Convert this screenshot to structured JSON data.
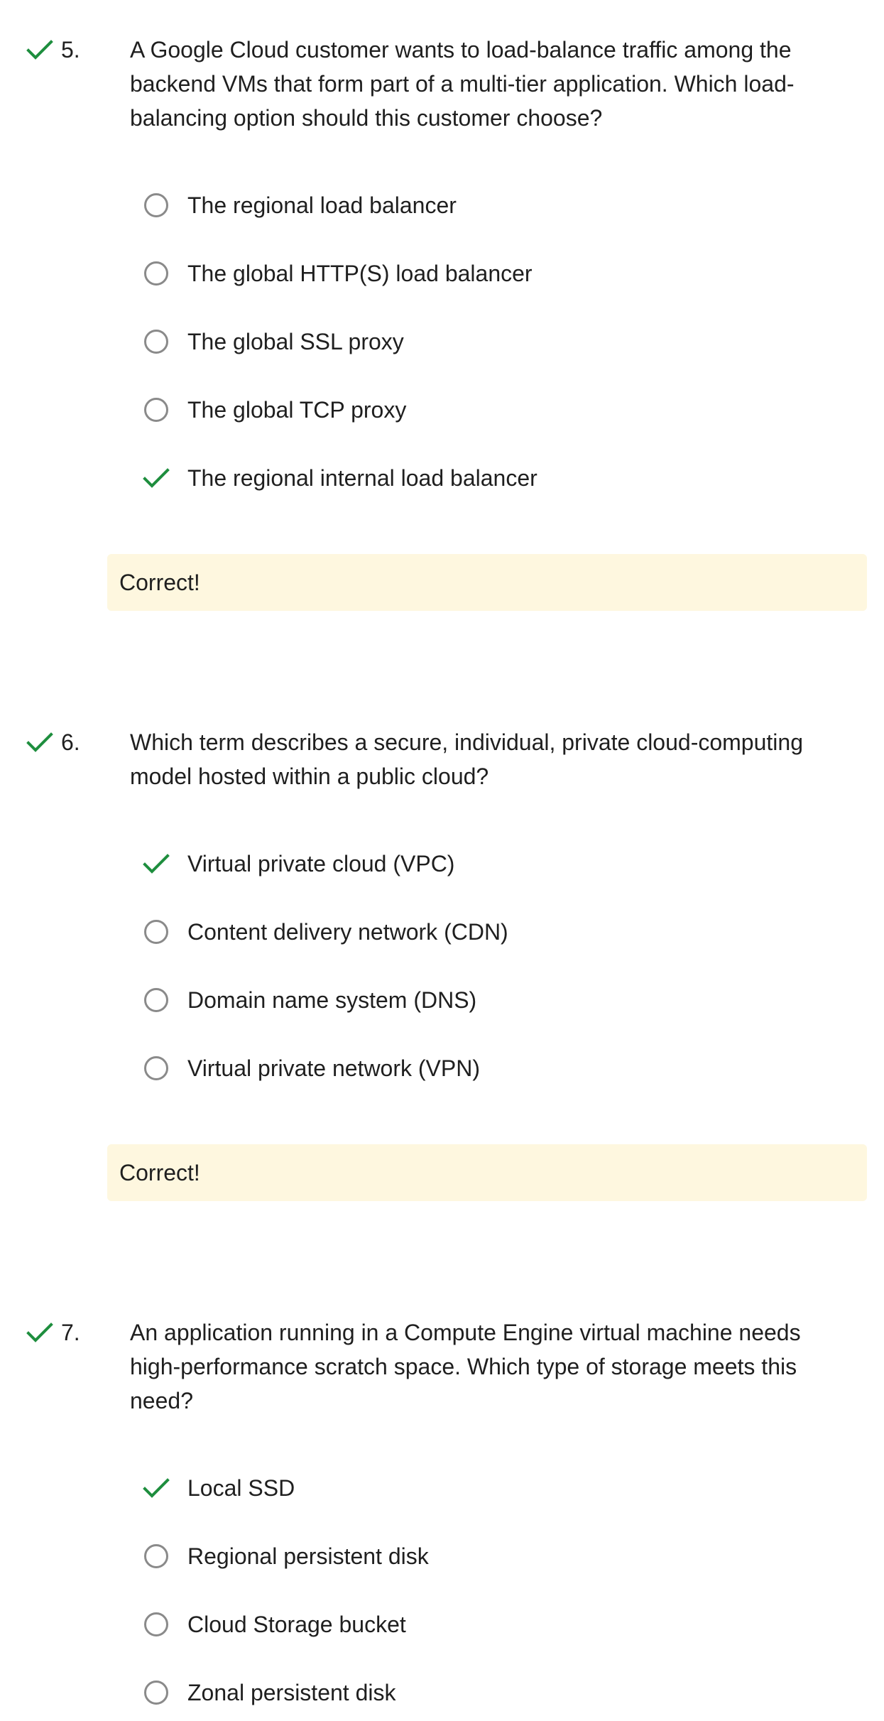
{
  "accent_color": "#1e8e3e",
  "feedback_bg": "#fef7df",
  "questions": [
    {
      "number": "5.",
      "status_icon": "check-icon",
      "text": "A Google Cloud customer wants to load-balance traffic among the backend VMs that form part of a multi-tier application. Which load-balancing option should this customer choose?",
      "options": [
        {
          "label": "The regional load balancer",
          "selected": false
        },
        {
          "label": "The global HTTP(S) load balancer",
          "selected": false
        },
        {
          "label": "The global SSL proxy",
          "selected": false
        },
        {
          "label": "The global TCP proxy",
          "selected": false
        },
        {
          "label": "The regional internal load balancer",
          "selected": true
        }
      ],
      "feedback": "Correct!"
    },
    {
      "number": "6.",
      "status_icon": "check-icon",
      "text": "Which term describes a secure, individual, private cloud-computing model hosted within a public cloud?",
      "options": [
        {
          "label": "Virtual private cloud (VPC)",
          "selected": true
        },
        {
          "label": "Content delivery network (CDN)",
          "selected": false
        },
        {
          "label": "Domain name system (DNS)",
          "selected": false
        },
        {
          "label": "Virtual private network (VPN)",
          "selected": false
        }
      ],
      "feedback": "Correct!"
    },
    {
      "number": "7.",
      "status_icon": "check-icon",
      "text": "An application running in a Compute Engine virtual machine needs high-performance scratch space. Which type of storage meets this need?",
      "options": [
        {
          "label": "Local SSD",
          "selected": true
        },
        {
          "label": "Regional persistent disk",
          "selected": false
        },
        {
          "label": "Cloud Storage bucket",
          "selected": false
        },
        {
          "label": "Zonal persistent disk",
          "selected": false
        }
      ]
    }
  ]
}
